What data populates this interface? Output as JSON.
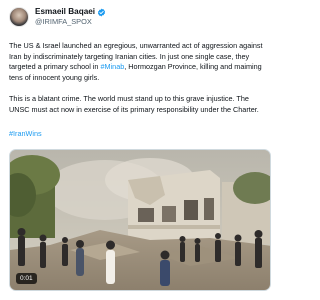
{
  "author": {
    "display_name": "Esmaeil Baqaei",
    "handle": "@IRIMFA_SPOX",
    "verified": true,
    "verified_color": "#1d9bf0"
  },
  "tweet": {
    "p1_before_link": "The US & Israel launched an egregious, unwarranted act of aggression against Iran by indiscriminately targeting Iranian cities. In just one single case, they targeted a primary school in ",
    "p1_link": "#Minab",
    "p1_after_link": ", Hormozgan Province, killing and maiming tens of innocent young girls.",
    "p2": "This is a blatant crime. The world must stand up to this grave injustice. The UNSC must act now in exercise of its primary responsibility under the Charter.",
    "hashtag": "#IranWins"
  },
  "media": {
    "type": "video",
    "timestamp": "0:01"
  },
  "colors": {
    "text": "#0f1419",
    "secondary_text": "#536471",
    "link": "#1d9bf0",
    "border": "#cfd9de"
  }
}
